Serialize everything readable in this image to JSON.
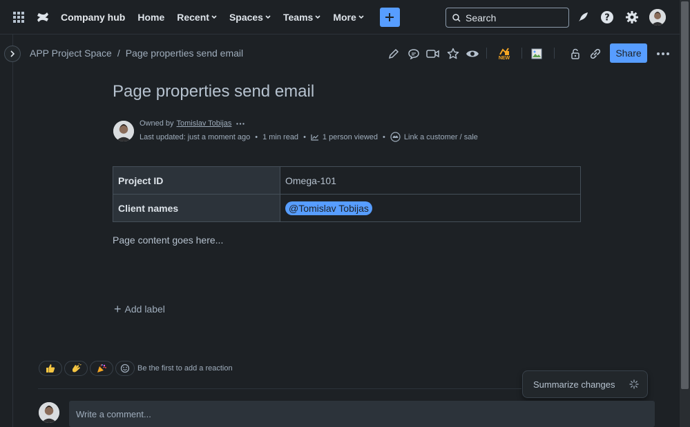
{
  "nav": {
    "product": "Company hub",
    "links": [
      "Home",
      "Recent",
      "Spaces",
      "Teams",
      "More"
    ],
    "search_placeholder": "Search"
  },
  "breadcrumb": {
    "space": "APP Project Space",
    "separator": "/",
    "page": "Page properties send email"
  },
  "toolbar": {
    "new_badge": "NEW",
    "share_label": "Share"
  },
  "page": {
    "title": "Page properties send email",
    "owned_by_label": "Owned by",
    "owner": "Tomislav Tobijas",
    "last_updated": "Last updated: just a moment ago",
    "read_time": "1 min read",
    "viewed": "1 person viewed",
    "link_customer": "Link a customer / sale"
  },
  "properties": [
    {
      "key": "Project ID",
      "value": "Omega-101"
    },
    {
      "key": "Client names",
      "value": "@Tomislav Tobijas"
    }
  ],
  "content": "Page content goes here...",
  "add_label": "Add label",
  "reactions": {
    "prompt": "Be the first to add a reaction"
  },
  "summarize": "Summarize changes",
  "comment_placeholder": "Write a comment...",
  "colors": {
    "background": "#1d2125",
    "accent": "#579dff",
    "table_header": "#2c333a"
  }
}
